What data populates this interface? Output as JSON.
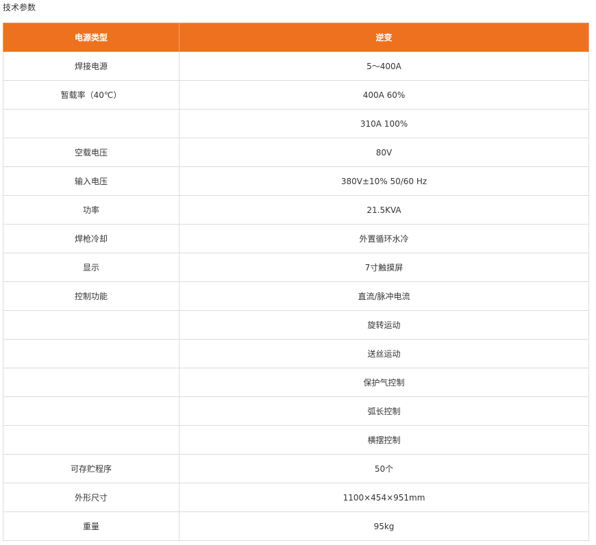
{
  "page": {
    "title": "技术参数"
  },
  "table": {
    "headers": [
      "电源类型",
      "逆变"
    ],
    "rows": [
      {
        "label": "焊接电源",
        "value": "5～400A"
      },
      {
        "label": "暂载率（40℃）",
        "value": "400A  60%"
      },
      {
        "label": "",
        "value": "310A  100%"
      },
      {
        "label": "空载电压",
        "value": "80V"
      },
      {
        "label": "输入电压",
        "value": "380V±10% 50/60 Hz"
      },
      {
        "label": "功率",
        "value": "21.5KVA"
      },
      {
        "label": "焊枪冷却",
        "value": "外置循环水冷"
      },
      {
        "label": "显示",
        "value": "7寸触摸屏"
      },
      {
        "label": "控制功能",
        "value": "直流/脉冲电流"
      },
      {
        "label": "",
        "value": "旋转运动"
      },
      {
        "label": "",
        "value": "送丝运动"
      },
      {
        "label": "",
        "value": "保护气控制"
      },
      {
        "label": "",
        "value": "弧长控制"
      },
      {
        "label": "",
        "value": "横摆控制"
      },
      {
        "label": "可存贮程序",
        "value": "50个"
      },
      {
        "label": "外形尺寸",
        "value": "1100×454×951mm"
      },
      {
        "label": "重量",
        "value": "95kg"
      }
    ]
  },
  "colors": {
    "header_bg": "#ee7120",
    "header_text": "#ffffff",
    "border": "#dcdcdc"
  }
}
